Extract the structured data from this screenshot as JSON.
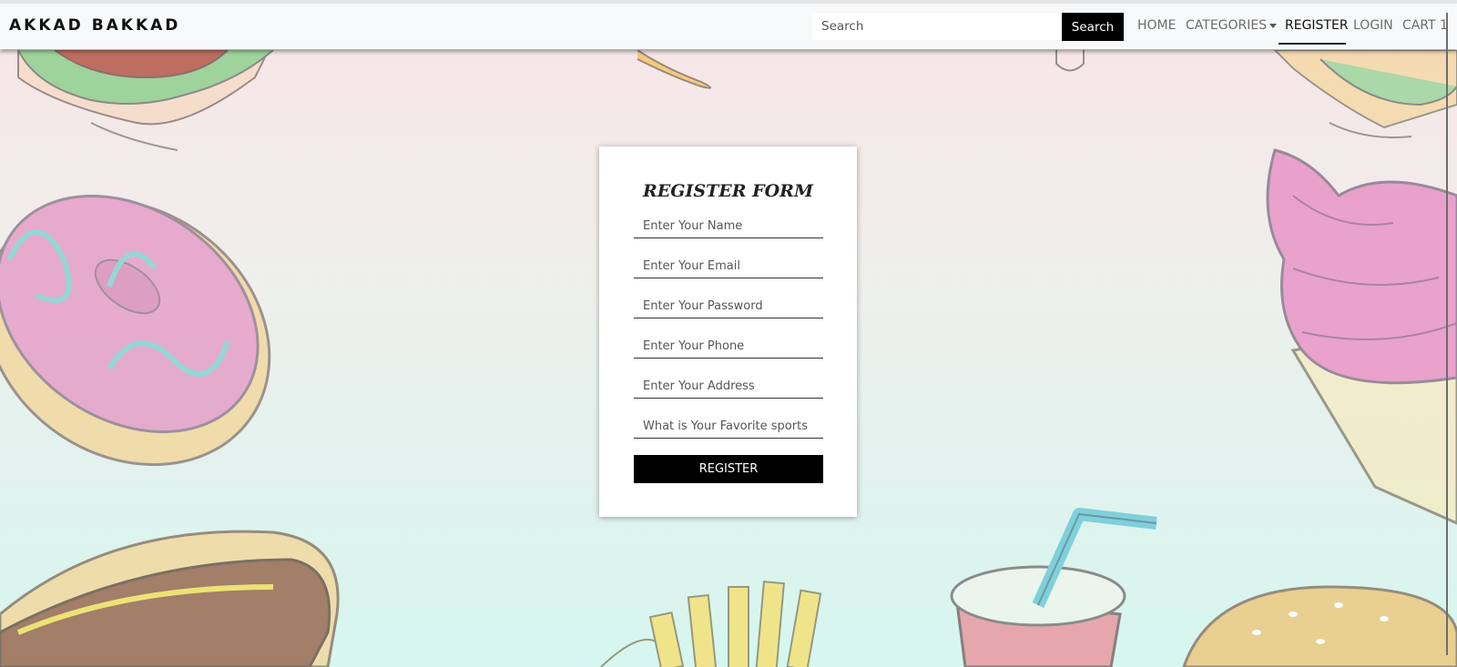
{
  "navbar": {
    "brand": "AKKAD BAKKAD",
    "search": {
      "placeholder": "Search",
      "button_label": "Search"
    },
    "links": {
      "home": "HOME",
      "categories": "CATEGORIES",
      "register": "REGISTER",
      "login": "LOGIN",
      "cart": "CART 1"
    }
  },
  "form": {
    "title": "REGISTER FORM",
    "fields": {
      "name": {
        "placeholder": "Enter Your Name",
        "value": ""
      },
      "email": {
        "placeholder": "Enter Your Email",
        "value": ""
      },
      "password": {
        "placeholder": "Enter Your Password",
        "value": ""
      },
      "phone": {
        "placeholder": "Enter Your Phone",
        "value": ""
      },
      "address": {
        "placeholder": "Enter Your Address",
        "value": ""
      },
      "sports": {
        "placeholder": "What is Your Favorite sports",
        "value": ""
      }
    },
    "submit_label": "REGISTER"
  },
  "icons": {
    "categories_caret": "chevron-down-icon"
  },
  "colors": {
    "navbar_bg": "#f8f9fa",
    "accent": "#000000",
    "bg_top": "#f7e6e8",
    "bg_bottom": "#d6f6ef"
  }
}
